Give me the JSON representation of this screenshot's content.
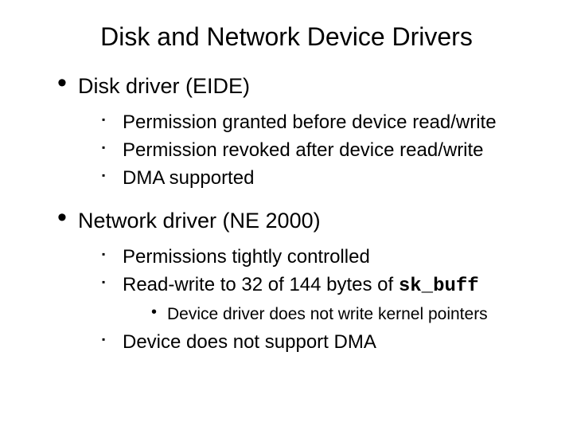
{
  "title": "Disk and Network Device Drivers",
  "points": [
    {
      "label": "Disk driver (EIDE)",
      "sub": [
        {
          "text": "Permission granted before device read/write"
        },
        {
          "text": "Permission revoked after device read/write"
        },
        {
          "text": "DMA supported"
        }
      ]
    },
    {
      "label": "Network driver (NE 2000)",
      "sub": [
        {
          "text": "Permissions tightly controlled"
        },
        {
          "text_prefix": "Read-write to 32 of 144 bytes of ",
          "code": "sk_buff",
          "subsub": [
            {
              "text": "Device driver does not write kernel pointers"
            }
          ]
        },
        {
          "text": "Device does not support DMA"
        }
      ]
    }
  ]
}
